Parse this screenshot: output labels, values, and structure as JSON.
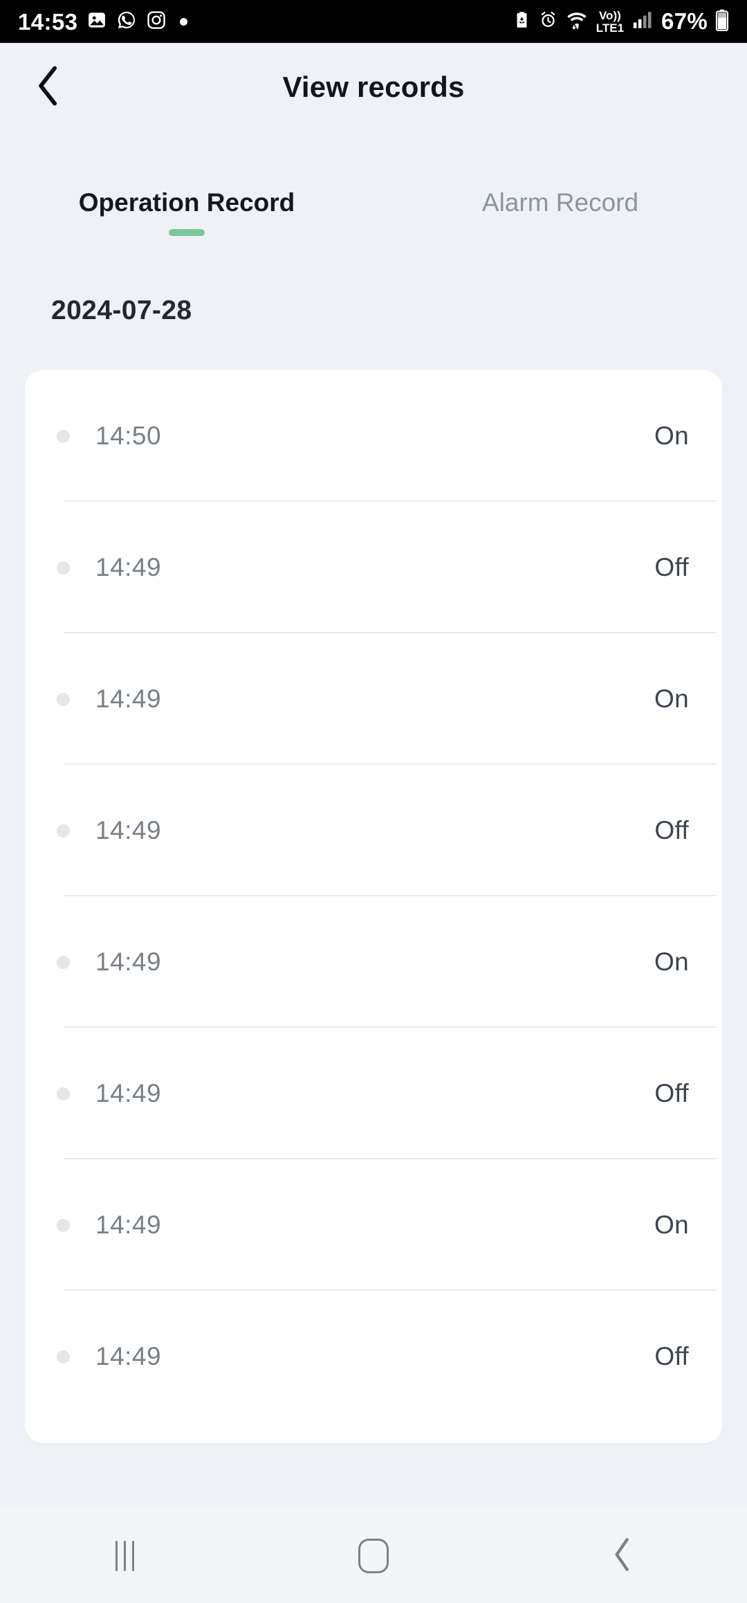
{
  "status_bar": {
    "clock": "14:53",
    "battery_percent": "67%",
    "network_label": "LTE1",
    "volte_label": "Vo))",
    "left_icons": [
      "gallery-icon",
      "whatsapp-icon",
      "instagram-icon",
      "notification-dot-icon"
    ],
    "right_icons": [
      "battery-saver-icon",
      "alarm-icon",
      "wifi-icon",
      "volte-icon",
      "signal-icon",
      "battery-icon"
    ]
  },
  "header": {
    "title": "View records",
    "back_icon": "chevron-left-icon"
  },
  "tabs": {
    "active_index": 0,
    "items": [
      {
        "label": "Operation Record",
        "active": true
      },
      {
        "label": "Alarm Record",
        "active": false
      }
    ],
    "indicator_color": "#79c79a"
  },
  "records": {
    "date": "2024-07-28",
    "rows": [
      {
        "time": "14:50",
        "state": "On"
      },
      {
        "time": "14:49",
        "state": "Off"
      },
      {
        "time": "14:49",
        "state": "On"
      },
      {
        "time": "14:49",
        "state": "Off"
      },
      {
        "time": "14:49",
        "state": "On"
      },
      {
        "time": "14:49",
        "state": "Off"
      },
      {
        "time": "14:49",
        "state": "On"
      },
      {
        "time": "14:49",
        "state": "Off"
      }
    ]
  },
  "nav_bar": {
    "buttons": [
      {
        "name": "recents-icon"
      },
      {
        "name": "home-icon"
      },
      {
        "name": "back-icon"
      }
    ]
  },
  "colors": {
    "page_background": "#eef2f6",
    "card_background": "#ffffff",
    "accent": "#79c79a",
    "time_text": "#787f86",
    "state_text": "#3d444e"
  }
}
